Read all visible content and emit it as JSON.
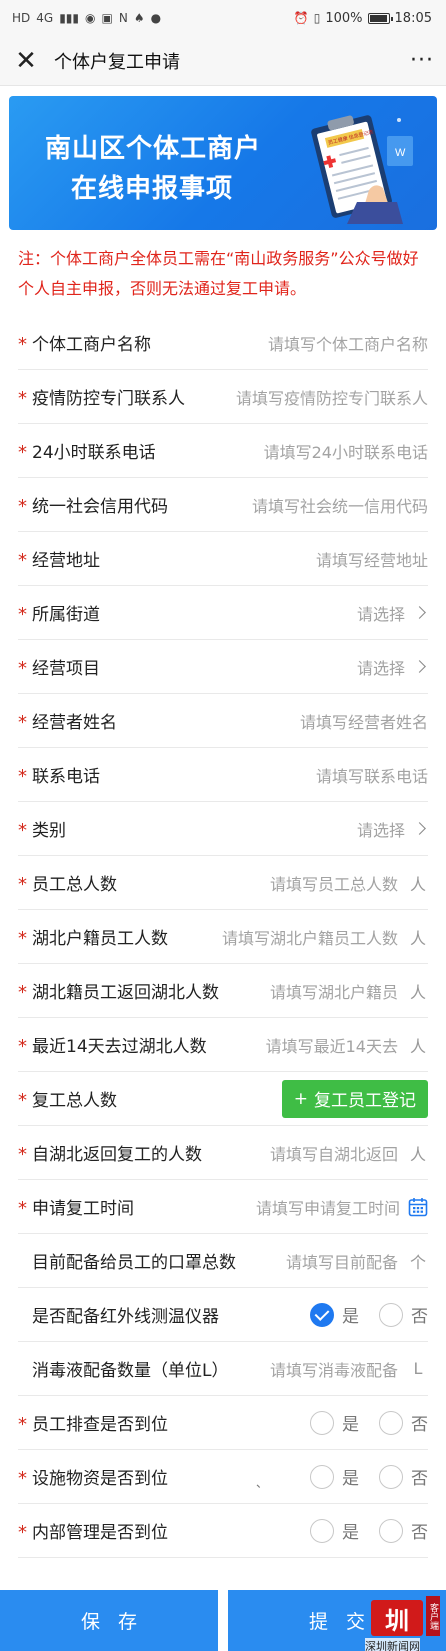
{
  "status_bar": {
    "left_glyphs": [
      "HD",
      "4G",
      "▮▮▮",
      "◉",
      "▣",
      "N",
      "♠",
      "●"
    ],
    "battery": "100%",
    "battery_level": 1.0,
    "time": "18:05"
  },
  "nav": {
    "title": "个体户复工申请",
    "close_icon": "close-icon",
    "more_label": "···"
  },
  "banner": {
    "line1": "南山区个体工商户",
    "line2": "在线申报事项",
    "art_note": "员工健康 信息登记表",
    "art_doc_letter": "W"
  },
  "notice": "注：个体工商户全体员工需在“南山政务服务”公众号做好个人自主申报，否则无法通过复工申请。",
  "form": {
    "rows": [
      {
        "label": "个体工商户名称",
        "placeholder": "请填写个体工商户名称"
      },
      {
        "label": "疫情防控专门联系人",
        "placeholder": "请填写疫情防控专门联系人"
      },
      {
        "label": "24小时联系电话",
        "placeholder": "请填写24小时联系电话"
      },
      {
        "label": "统一社会信用代码",
        "placeholder": "请填写社会统一信用代码"
      },
      {
        "label": "经营地址",
        "placeholder": "请填写经营地址"
      },
      {
        "label": "所属街道",
        "select": "请选择"
      },
      {
        "label": "经营项目",
        "select": "请选择"
      },
      {
        "label": "经营者姓名",
        "placeholder": "请填写经营者姓名"
      },
      {
        "label": "联系电话",
        "placeholder": "请填写联系电话"
      },
      {
        "label": "类别",
        "select": "请选择"
      },
      {
        "label": "员工总人数",
        "placeholder": "请填写员工总人数",
        "unit": "人"
      },
      {
        "label": "湖北户籍员工人数",
        "placeholder": "请填写湖北户籍员工人数",
        "unit": "人"
      },
      {
        "label": "湖北籍员工返回湖北人数",
        "placeholder": "请填写湖北户籍员",
        "unit": "人"
      },
      {
        "label": "最近14天去过湖北人数",
        "placeholder": "请填写最近14天去",
        "unit": "人"
      },
      {
        "label": "复工总人数",
        "button": "复工员工登记",
        "button_icon": "+"
      },
      {
        "label": "自湖北返回复工的人数",
        "placeholder": "请填写自湖北返回",
        "unit": "人"
      },
      {
        "label": "申请复工时间",
        "placeholder": "请填写申请复工时间"
      },
      {
        "label": "目前配备给员工的口罩总数",
        "placeholder": "请填写目前配备",
        "unit": "个"
      },
      {
        "label": "是否配备红外线测温仪器",
        "yes": "是",
        "no": "否"
      },
      {
        "label": "消毒液配备数量（单位L）",
        "placeholder": "请填写消毒液配备",
        "unit": "L"
      },
      {
        "label": "员工排查是否到位",
        "yes": "是",
        "no": "否"
      },
      {
        "label": "设施物资是否到位",
        "yes": "是",
        "no": "否",
        "stray_mark": "、"
      },
      {
        "label": "内部管理是否到位",
        "yes": "是",
        "no": "否"
      }
    ],
    "required_mark": "*"
  },
  "bottom": {
    "save": "保存",
    "submit": "提交"
  },
  "watermark": {
    "logo": "圳",
    "side": "客户端",
    "text": "深圳新闻网"
  },
  "colors": {
    "primary": "#2a8cf0",
    "green": "#3fbd45",
    "red": "#e0241b",
    "checked": "#1f79f0"
  }
}
